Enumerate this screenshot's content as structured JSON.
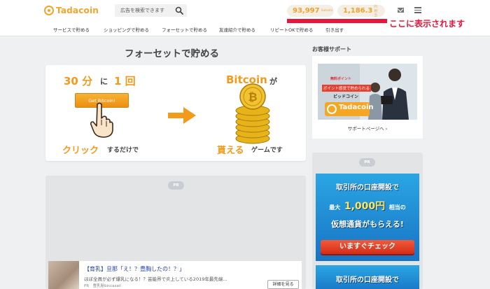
{
  "header": {
    "logo_text": "Tadacoin",
    "search_placeholder": "広告を検索できます",
    "satoshi_value": "93,997",
    "satoshi_unit": "Satoshi",
    "yen_value": "1,186.3",
    "yen_unit": "円相当",
    "nav": [
      "サービスで貯める",
      "ショッピングで貯める",
      "フォーセットで貯める",
      "友達紹介で貯める",
      "リピートOKで貯める",
      "引き出す"
    ],
    "annotation": "ここに表示されます",
    "accent_color": "#f2a52a",
    "annotation_color": "#e8163a"
  },
  "main": {
    "title": "フォーセットで貯める",
    "hero": {
      "line1_a": "30 分",
      "line1_b": "に",
      "line1_c": "1 回",
      "button": "Get Bitcoin!",
      "click_a": "クリック",
      "click_b": "するだけで",
      "right_a": "Bitcoin",
      "right_b": "が",
      "right_c": "貰える",
      "right_d": "ゲームです"
    },
    "pr_label": "PR",
    "ad": {
      "title": "【育乳】旦那「え！？豊胸したの！？」",
      "desc": "ほぼ全員が必ず爆乳になる！？芸能界で炎上している2019年最先端...",
      "source": "PR　豊乳秘biccasail",
      "detail_button": "詳細を見る"
    }
  },
  "sidebar": {
    "title": "お客様サポート",
    "image_text_1": "無料ポイント",
    "image_text_2": "ポイント感覚で貯められる",
    "image_text_3": "ビッドコイン",
    "image_logo": "Tadacoin",
    "support_link": "サポートページへ ›",
    "pr_label": "PR",
    "banner": {
      "line1": "取引所の口座開設で",
      "line2_a": "最大",
      "line2_b": "1,000円",
      "line2_c": "相当の",
      "line3": "仮想通貨がもらえる!",
      "cta": "いますぐチェック",
      "line4": "取引所の口座開設で"
    }
  }
}
